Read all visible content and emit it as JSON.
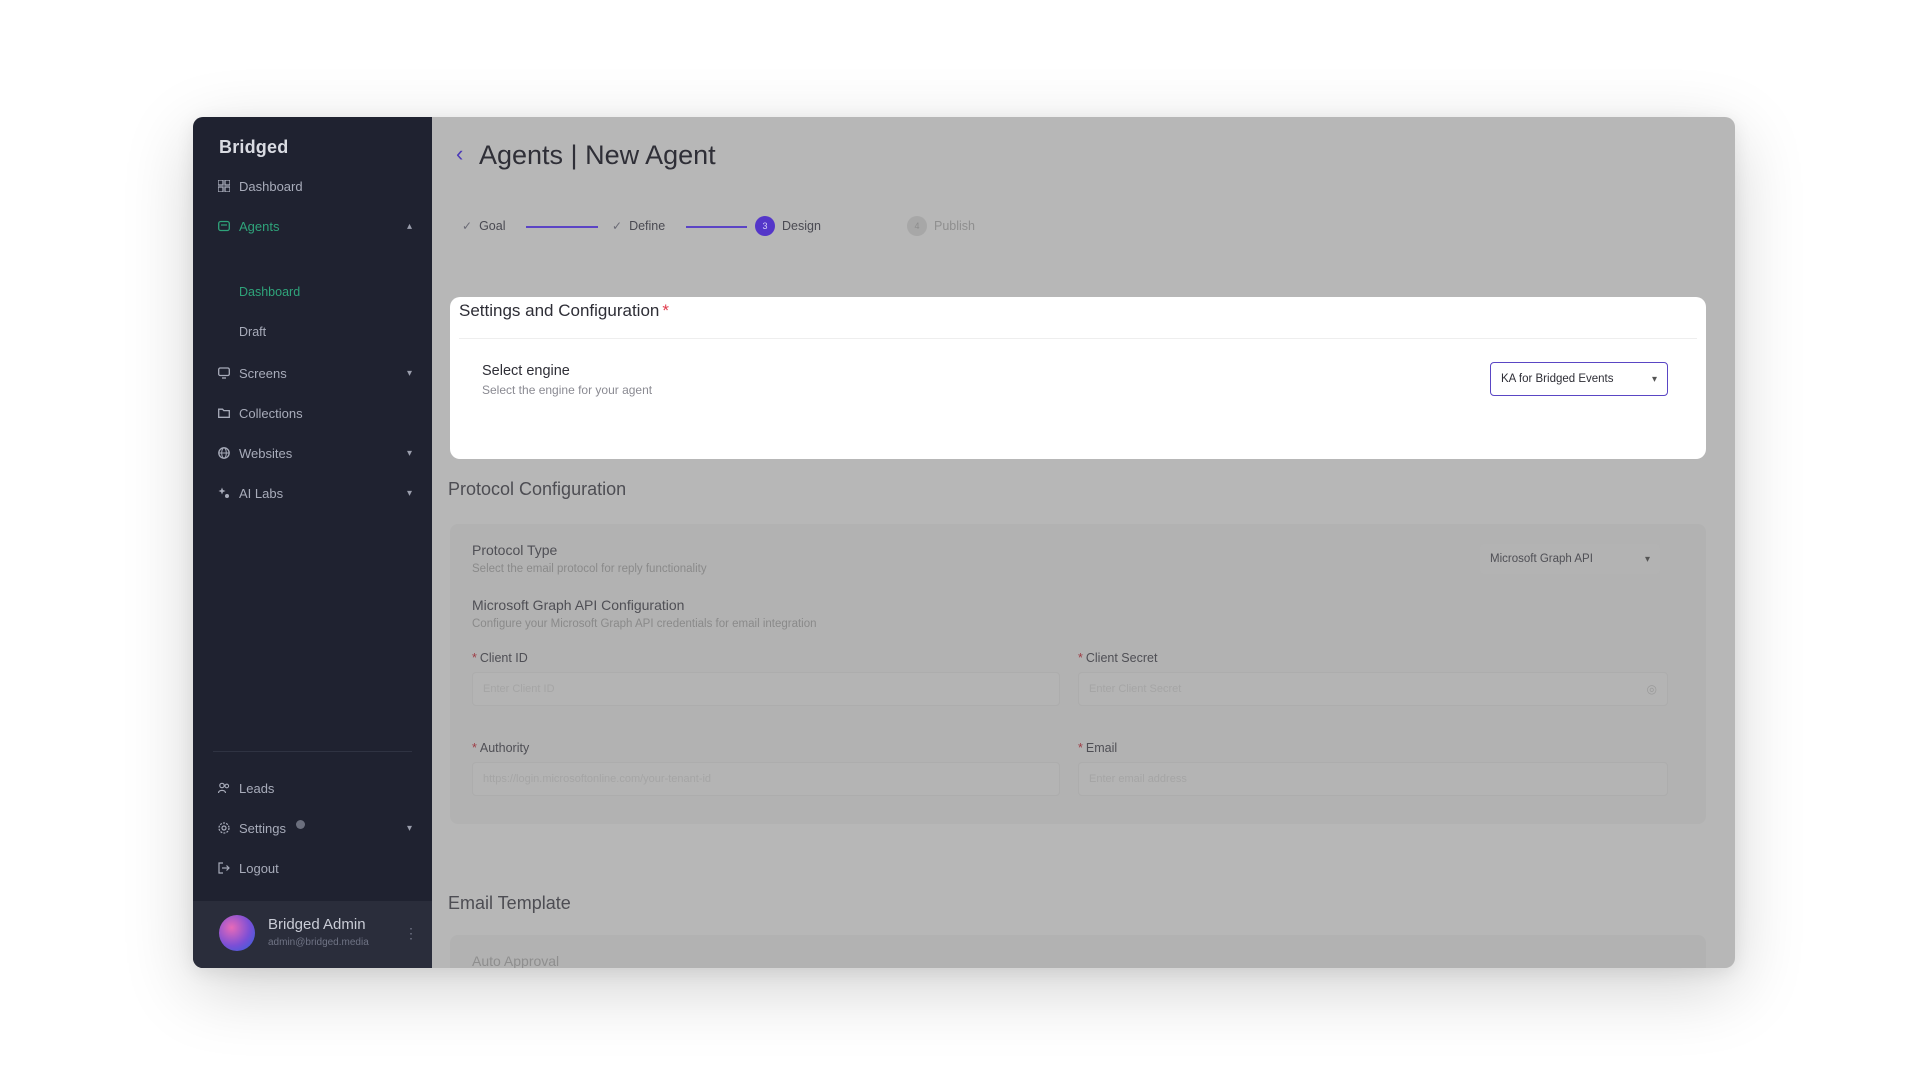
{
  "app": {
    "logo": "Bridged"
  },
  "sidebar": {
    "items": [
      {
        "label": "Dashboard",
        "icon": "grid-icon"
      },
      {
        "label": "Agents",
        "icon": "agent-icon",
        "active": true,
        "expanded": true
      },
      {
        "label": "Screens",
        "icon": "monitor-icon"
      },
      {
        "label": "Collections",
        "icon": "folder-icon"
      },
      {
        "label": "Websites",
        "icon": "globe-icon"
      },
      {
        "label": "AI Labs",
        "icon": "sparkle-icon"
      }
    ],
    "agents_sub": [
      {
        "label": "Dashboard",
        "active": true
      },
      {
        "label": "Draft"
      }
    ],
    "bottom_items": [
      {
        "label": "Leads",
        "icon": "users-icon"
      },
      {
        "label": "Settings",
        "icon": "gear-icon"
      },
      {
        "label": "Logout",
        "icon": "logout-icon"
      }
    ],
    "user": {
      "name": "Bridged Admin",
      "email": "admin@bridged.media"
    }
  },
  "header": {
    "title": "Agents | New Agent"
  },
  "stepper": {
    "steps": [
      {
        "label": "Goal",
        "state": "done"
      },
      {
        "label": "Define",
        "state": "done"
      },
      {
        "label": "Design",
        "state": "current",
        "number": "3"
      },
      {
        "label": "Publish",
        "state": "pending",
        "number": "4"
      }
    ]
  },
  "settings": {
    "title": "Settings and Configuration",
    "required_mark": "*",
    "engine_label": "Select engine",
    "engine_desc": "Select the engine for your agent",
    "engine_value": "KA for Bridged Events"
  },
  "protocol": {
    "title": "Protocol Configuration",
    "type_label": "Protocol Type",
    "type_desc": "Select the email protocol for reply functionality",
    "type_value": "Microsoft Graph API",
    "graph_label": "Microsoft Graph API Configuration",
    "graph_desc": "Configure your Microsoft Graph API credentials for email integration",
    "fields": {
      "client_id": {
        "label": "Client ID",
        "placeholder": "Enter Client ID"
      },
      "client_secret": {
        "label": "Client Secret",
        "placeholder": "Enter Client Secret"
      },
      "authority": {
        "label": "Authority",
        "placeholder": "https://login.microsoftonline.com/your-tenant-id"
      },
      "email": {
        "label": "Email",
        "placeholder": "Enter email address"
      }
    }
  },
  "email_template": {
    "title": "Email Template",
    "auto_approval_label": "Auto Approval"
  },
  "colors": {
    "accent": "#5436c9",
    "active_nav": "#2fa37a",
    "required": "#e0394a",
    "sidebar_bg": "#1f2230"
  }
}
